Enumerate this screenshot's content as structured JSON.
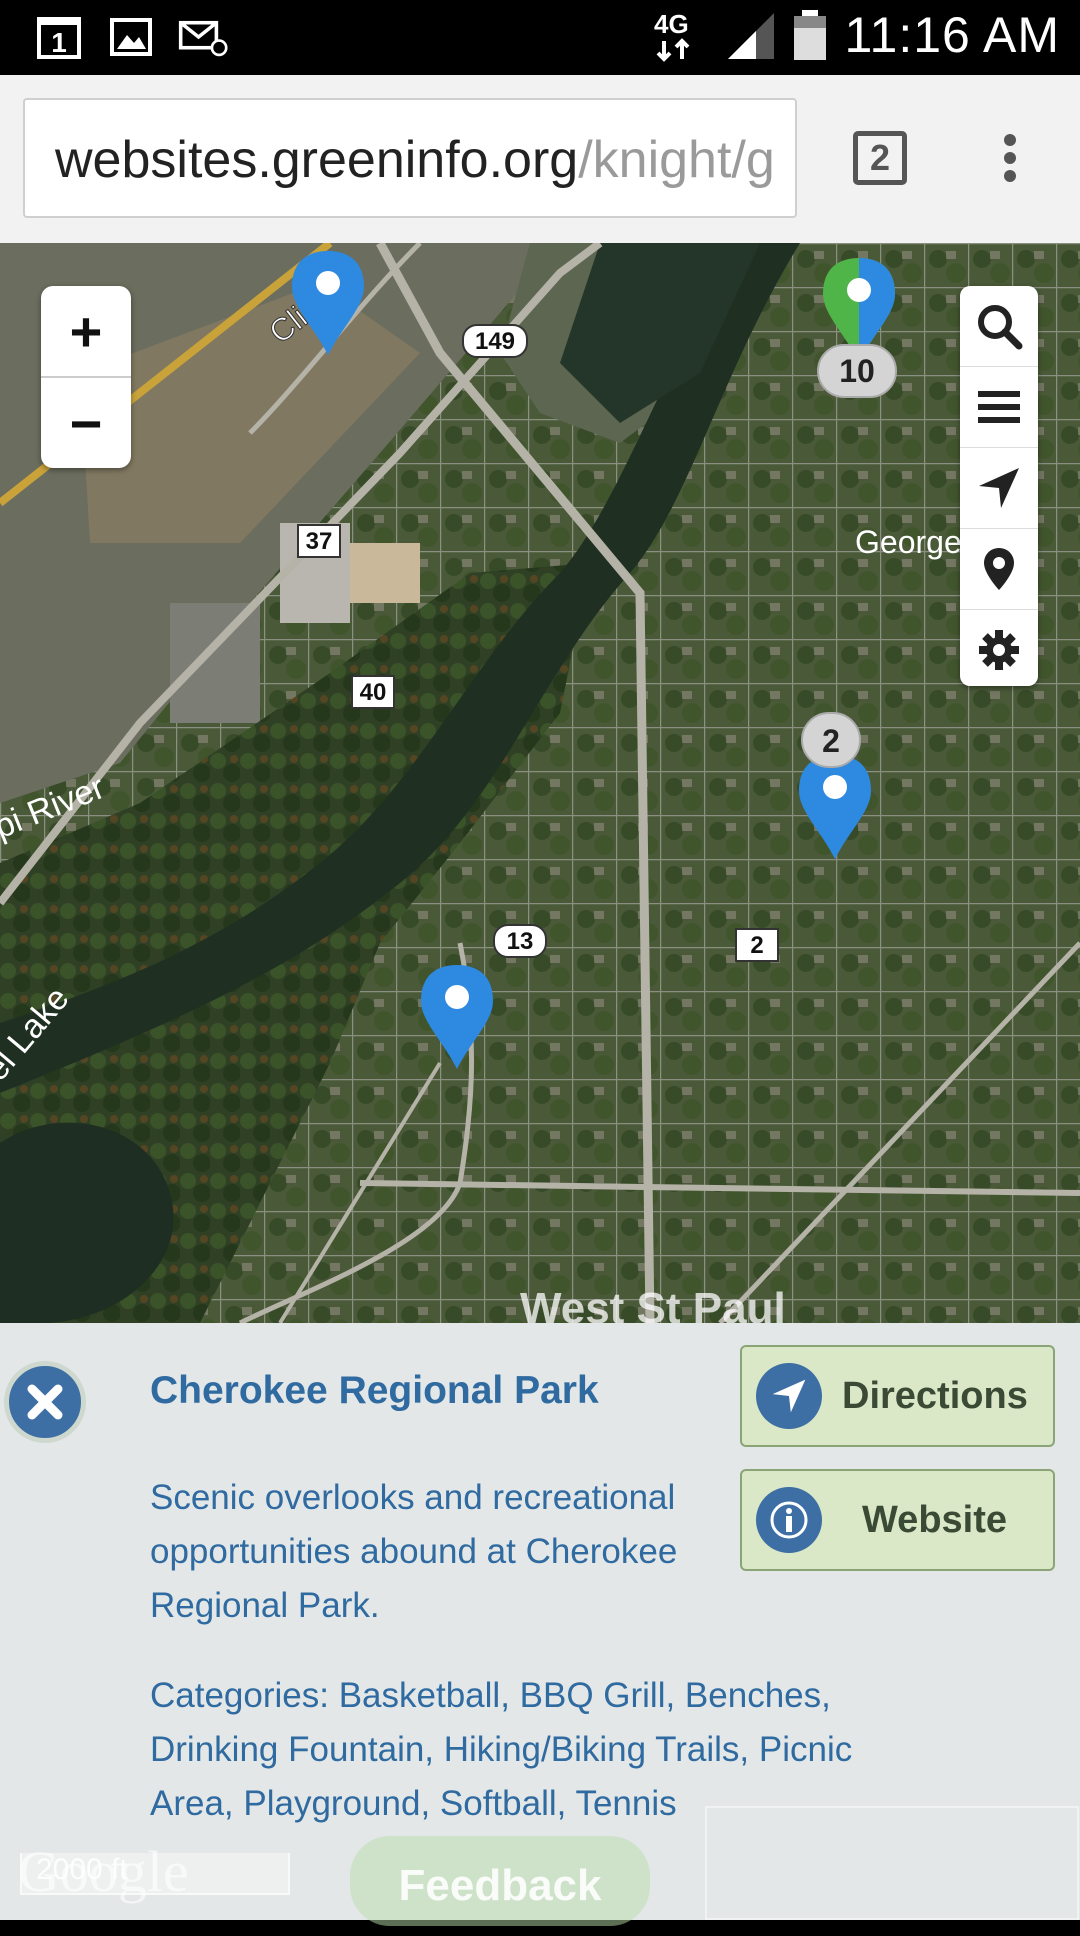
{
  "status_bar": {
    "notification_icons": [
      "calendar-icon",
      "gallery-icon",
      "email-icon"
    ],
    "calendar_day": "1",
    "network": "4G",
    "time": "11:16 AM"
  },
  "browser": {
    "url_host": "websites.greeninfo.org",
    "url_path": "/knight/g",
    "tab_count": "2"
  },
  "map": {
    "labels": {
      "cliff_st": "Cliff St",
      "george": "George",
      "river": "pi River",
      "lake": "el Lake",
      "west_st_paul": "West St Paul"
    },
    "road_shields": [
      "149",
      "37",
      "40",
      "13",
      "2"
    ],
    "cluster_counts": {
      "green": "10",
      "blue": "2"
    },
    "zoom_in": "+",
    "zoom_out": "−",
    "tools": [
      "search-icon",
      "list-icon",
      "navigate-icon",
      "location-pin-icon",
      "settings-icon"
    ]
  },
  "panel": {
    "title": "Cherokee Regional Park",
    "description": "Scenic overlooks and recreational opportunities abound at Cherokee Regional Park.",
    "categories": "Categories: Basketball, BBQ Grill, Benches, Drinking Fountain, Hiking/Biking Trails, Picnic Area, Playground, Softball, Tennis",
    "directions_label": "Directions",
    "website_label": "Website",
    "scale_label": "2000 ft",
    "attribution": "Google",
    "feedback_label": "Feedback"
  },
  "colors": {
    "accent_blue": "#3d6fa4",
    "title_blue": "#2f6aa0",
    "button_green": "#dbe8c8",
    "marker_blue": "#2d8ae0",
    "marker_green": "#4fb548"
  }
}
